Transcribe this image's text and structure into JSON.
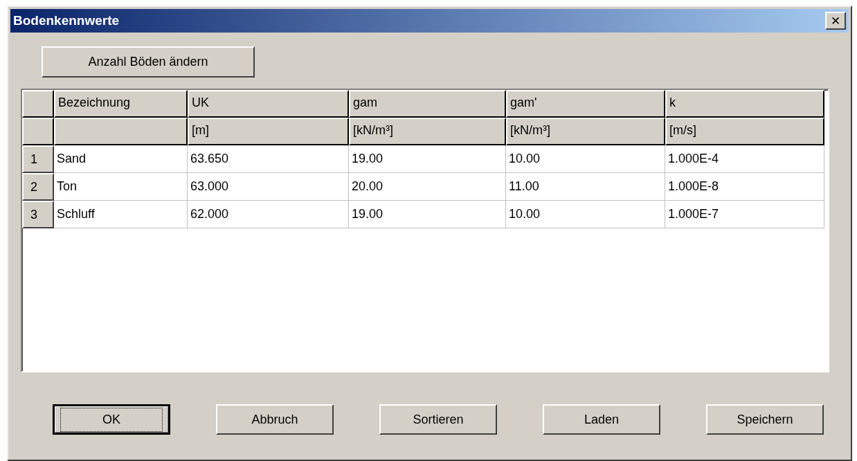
{
  "window": {
    "title": "Bodenkennwerte",
    "close": "✕"
  },
  "top_button": {
    "label": "Anzahl Böden ändern"
  },
  "table": {
    "columns": [
      {
        "name": "Bezeichnung"
      },
      {
        "name": "UK",
        "unit": "[m]"
      },
      {
        "name": "gam",
        "unit": "[kN/m³]"
      },
      {
        "name": "gam'",
        "unit": "[kN/m³]"
      },
      {
        "name": "k",
        "unit": "[m/s]"
      }
    ],
    "rows": [
      {
        "index": "1",
        "cells": [
          "Sand",
          "63.650",
          "19.00",
          "10.00",
          "1.000E-4"
        ]
      },
      {
        "index": "2",
        "cells": [
          "Ton",
          "63.000",
          "20.00",
          "11.00",
          "1.000E-8"
        ]
      },
      {
        "index": "3",
        "cells": [
          "Schluff",
          "62.000",
          "19.00",
          "10.00",
          "1.000E-7"
        ]
      }
    ]
  },
  "buttons": [
    {
      "label": "OK",
      "focused": true
    },
    {
      "label": "Abbruch",
      "focused": false
    },
    {
      "label": "Sortieren",
      "focused": false
    },
    {
      "label": "Laden",
      "focused": false
    },
    {
      "label": "Speichern",
      "focused": false
    }
  ]
}
